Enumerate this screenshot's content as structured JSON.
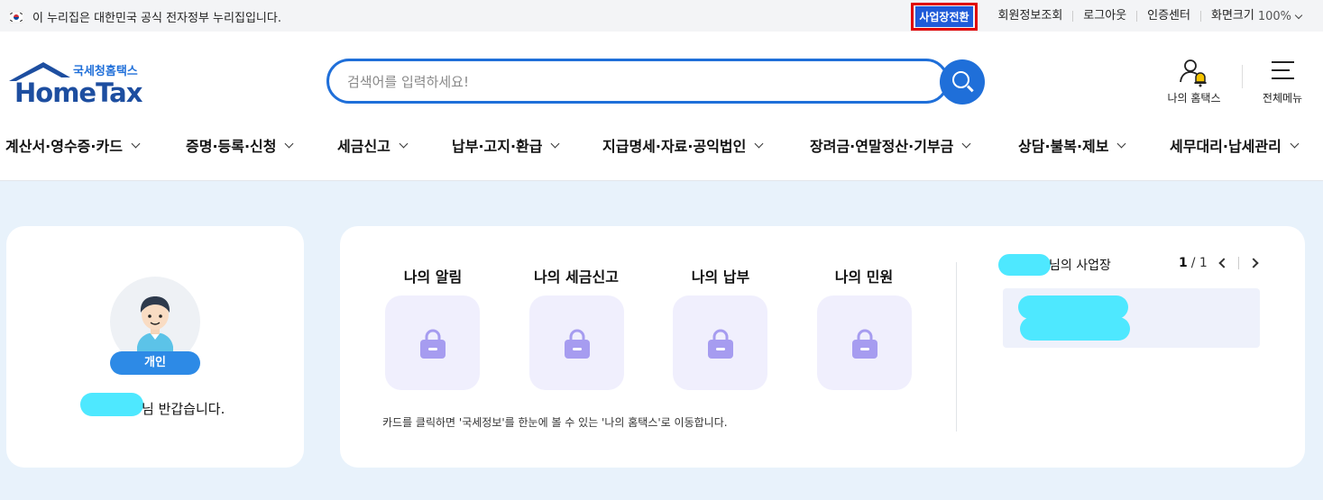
{
  "gov_bar": {
    "notice": "이 누리집은 대한민국 공식 전자정부 누리집입니다.",
    "switch_label": "사업장전환",
    "links": [
      "회원정보조회",
      "로그아웃",
      "인증센터",
      "화면크기"
    ],
    "zoom": "100%"
  },
  "header": {
    "logo_sub": "국세청홈택스",
    "logo_main": "HomeTax",
    "search_placeholder": "검색어를 입력하세요!",
    "my_hometax": "나의 홈택스",
    "all_menu": "전체메뉴"
  },
  "nav": {
    "items": [
      "계산서·영수증·카드",
      "증명·등록·신청",
      "세금신고",
      "납부·고지·환급",
      "지급명세·자료·공익법인",
      "장려금·연말정산·기부금",
      "상담·불복·제보",
      "세무대리·납세관리"
    ]
  },
  "profile": {
    "badge": "개인",
    "greeting_suffix": "님 반갑습니다."
  },
  "dashboard": {
    "tiles": [
      "나의 알림",
      "나의 세금신고",
      "나의 납부",
      "나의 민원"
    ],
    "notice": "카드를 클릭하면 '국세정보'를 한눈에 볼 수 있는 '나의 홈택스'로 이동합니다.",
    "business_suffix": "님의 사업장",
    "page_current": "1",
    "page_total": "/ 1"
  },
  "colors": {
    "accent": "#1f6fd9",
    "highlight_border": "#e00000",
    "masked": "#4ee8ff",
    "main_bg": "#e8f2fb"
  }
}
